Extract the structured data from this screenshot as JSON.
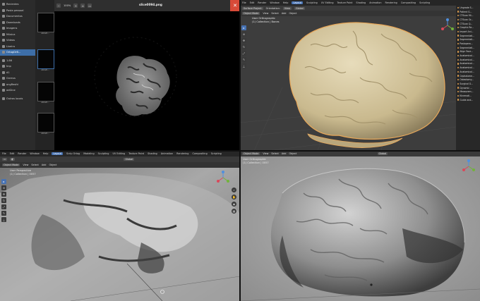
{
  "file_manager": {
    "items": [
      {
        "label": "Recientes",
        "icon": "clock-icon"
      },
      {
        "label": "Pasta pessoal",
        "icon": "home-icon"
      },
      {
        "label": "Documentos",
        "icon": "folder-icon"
      },
      {
        "label": "Downloads",
        "icon": "folder-icon"
      },
      {
        "label": "Imagens",
        "icon": "folder-icon"
      },
      {
        "label": "Música",
        "icon": "folder-icon"
      },
      {
        "label": "Vídeos",
        "icon": "folder-icon"
      },
      {
        "label": "Lixeira",
        "icon": "trash-icon"
      },
      {
        "label": "OrtogDrB...",
        "icon": "folder-icon"
      },
      {
        "label": "1.86",
        "icon": "drive-icon"
      },
      {
        "label": "hnp",
        "icon": "drive-icon"
      },
      {
        "label": "d1",
        "icon": "drive-icon"
      },
      {
        "label": "Gnreus",
        "icon": "drive-icon"
      },
      {
        "label": "ongResfd",
        "icon": "drive-icon"
      },
      {
        "label": "adGine",
        "icon": "drive-icon"
      },
      {
        "label": "Outros locais",
        "icon": "plus-icon"
      }
    ],
    "selected_index": 8
  },
  "thumbnails": [
    "slice0...",
    "slice0...",
    "slice0...",
    "slice0..."
  ],
  "viewer": {
    "title": "slice0094.png",
    "zoom": "100%"
  },
  "top_right": {
    "menus": [
      "File",
      "Edit",
      "Render",
      "Window",
      "Help"
    ],
    "workspaces": [
      "Layout",
      "Sculpting",
      "UV Editing",
      "Texture Paint",
      "Shading",
      "Animation",
      "Rendering",
      "Compositing",
      "Scripting"
    ],
    "active_workspace": "Layout",
    "header_items": [
      "Object Mode",
      "View",
      "Select",
      "Add",
      "Object"
    ],
    "transform": "Surface Project",
    "orientation": "Orientation:",
    "orientation_value": "View",
    "global": "Global",
    "viewport_title": "User Orthographic",
    "viewport_sub": "(1) Collection | Bones",
    "outliner_rows": [
      "Ungrade S...",
      "Patient G...",
      "CTScan Mi...",
      "CTScan Or...",
      "CTScan Q...",
      "Graphic Re...",
      "Import Ani...",
      "Segmentati...",
      "Segmentati...",
      "Postopera...",
      "Segmentati...",
      "Align Face...",
      "Anatomical...",
      "Anatomical...",
      "Anatomical...",
      "Anatomical...",
      "Anatomical...",
      "Cephalome...",
      "Osteotomy...",
      "Surgical G...",
      "Dynamic ...",
      "Measurem...",
      "Kinemati...",
      "Guide and..."
    ]
  },
  "bottom_left": {
    "menus": [
      "File",
      "Edit",
      "Render",
      "Window",
      "Help"
    ],
    "workspaces": [
      "Layout",
      "Scrip Ortog",
      "Modeling",
      "Sculpting",
      "UV Editing",
      "Texture Paint",
      "Shading",
      "Animation",
      "Rendering",
      "Compositing",
      "Scripting"
    ],
    "active_workspace": "Layout",
    "header_items": [
      "Object Mode",
      "View",
      "Select",
      "Add",
      "Object"
    ],
    "global": "Global",
    "viewport_title": "User Perspective",
    "viewport_sub": "(1) Collection | 0057"
  },
  "bottom_right": {
    "header_items": [
      "Object Mode",
      "View",
      "Select",
      "Add",
      "Object"
    ],
    "global": "Global",
    "viewport_title": "User Orthographic",
    "viewport_sub": "(1) Collection | 0057"
  },
  "colors": {
    "accent": "#4772b3",
    "close": "#d84a38",
    "brain_mesh": "#d9cba3",
    "selection_outline": "#e8a85a"
  }
}
